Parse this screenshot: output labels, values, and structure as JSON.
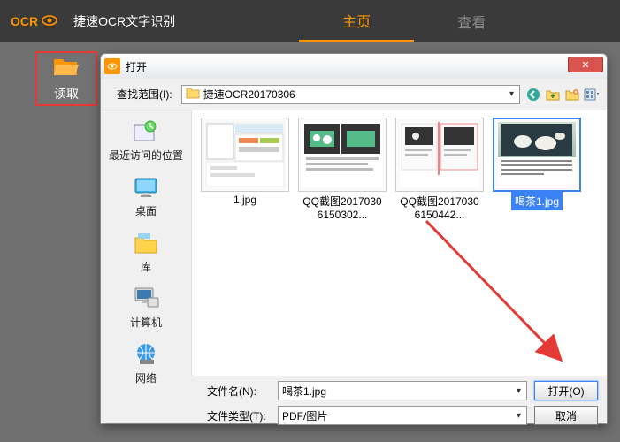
{
  "app": {
    "logo_text": "OCR",
    "title": "捷速OCR文字识别",
    "tabs": [
      {
        "label": "主页",
        "active": true
      },
      {
        "label": "查看",
        "active": false
      }
    ]
  },
  "toolbar": {
    "read_label": "读取"
  },
  "dialog": {
    "title": "打开",
    "search_range_label": "查找范围(I):",
    "current_dir": "捷速OCR20170306",
    "sidebar": [
      {
        "id": "recent",
        "label": "最近访问的位置"
      },
      {
        "id": "desktop",
        "label": "桌面"
      },
      {
        "id": "libraries",
        "label": "库"
      },
      {
        "id": "computer",
        "label": "计算机"
      },
      {
        "id": "network",
        "label": "网络"
      }
    ],
    "files": [
      {
        "name": "1.jpg",
        "selected": false
      },
      {
        "name": "QQ截图20170306150302...",
        "selected": false
      },
      {
        "name": "QQ截图20170306150442...",
        "selected": false
      },
      {
        "name": "喝茶1.jpg",
        "selected": true
      }
    ],
    "filename_label": "文件名(N):",
    "filename_value": "喝茶1.jpg",
    "filetype_label": "文件类型(T):",
    "filetype_value": "PDF/图片",
    "open_btn": "打开(O)",
    "cancel_btn": "取消"
  }
}
